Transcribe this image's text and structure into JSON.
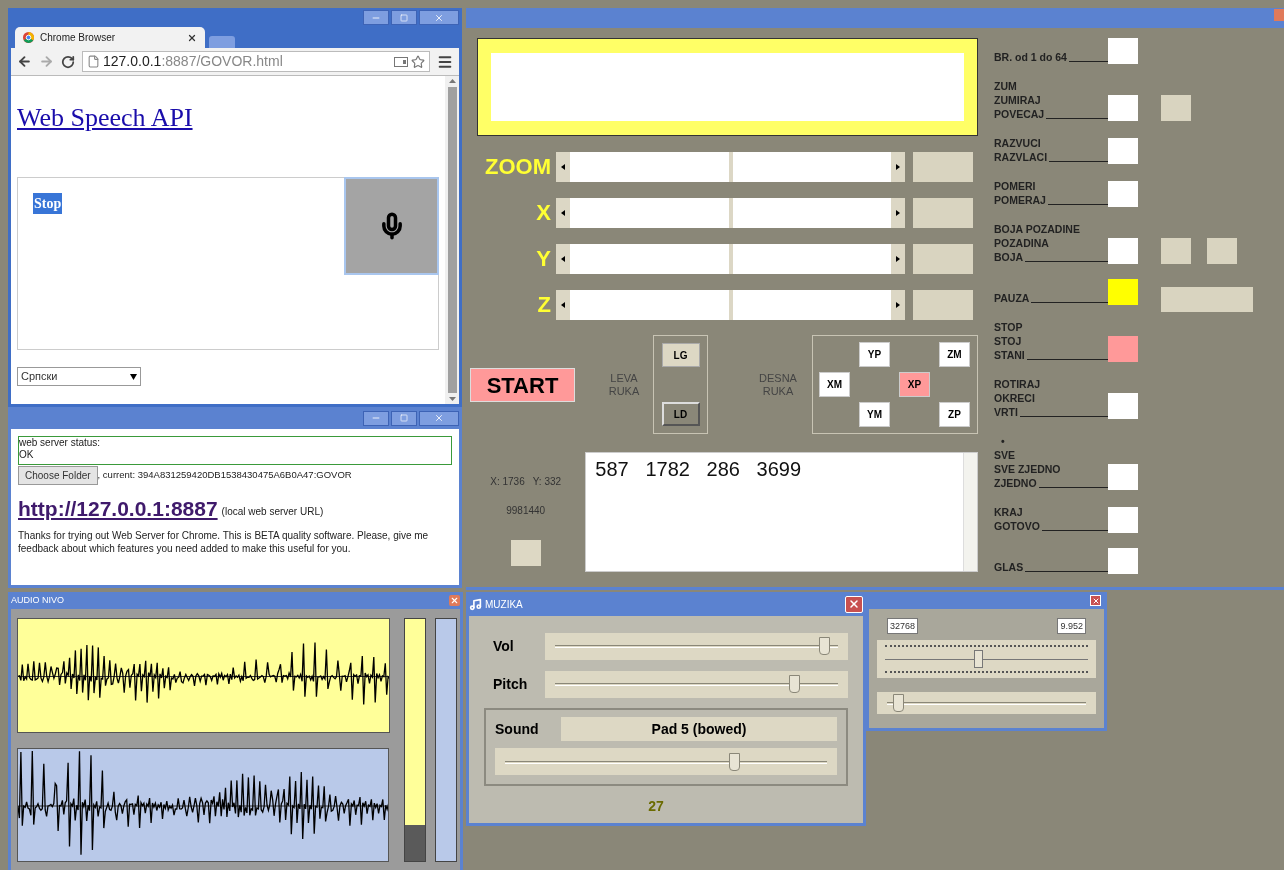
{
  "browser": {
    "tab": {
      "title": "Chrome Browser"
    },
    "url": {
      "host": "127.0.0.1",
      "rest": ":8887/GOVOR.html"
    },
    "page": {
      "heading": "Web Speech API",
      "transcript": "Stop",
      "transcript_selected": true,
      "language": "Српски"
    }
  },
  "server": {
    "status_lines": [
      "web server status:",
      "OK"
    ],
    "choose_folder": "Choose Folder",
    "current": ", current: 394A831259420DB1538430475A6B0A47:GOVOR",
    "url": "http://127.0.0.1:8887",
    "url_note": "(local web server URL)",
    "note": "Thanks for trying out Web Server for Chrome. This is BETA quality software. Please, give me feedback about which features you need added to make this useful for you."
  },
  "audio": {
    "title": "AUDIO NIVO",
    "meters": [
      {
        "level": 0.15
      },
      {
        "level": 0
      }
    ]
  },
  "main": {
    "axes": [
      {
        "label": "ZOOM",
        "level": 0.5
      },
      {
        "label": "X",
        "level": 0.5
      },
      {
        "label": "Y",
        "level": 0.5
      },
      {
        "label": "Z",
        "level": 0.5
      }
    ],
    "start": "START",
    "left_hand": {
      "lines": [
        "LEVA",
        "RUKA"
      ],
      "buttons": [
        {
          "label": "LG",
          "pressed": false
        },
        {
          "label": "LD",
          "pressed": true
        }
      ]
    },
    "right_hand": {
      "lines": [
        "DESNA",
        "RUKA"
      ],
      "buttons": [
        {
          "label": "YP",
          "selected": false
        },
        {
          "label": "ZM",
          "selected": false
        },
        {
          "label": "XM",
          "selected": false
        },
        {
          "label": "XP",
          "selected": true
        },
        {
          "label": "YM",
          "selected": false
        },
        {
          "label": "ZP",
          "selected": false
        }
      ]
    },
    "coords": [
      "X: 1736",
      "Y: 332"
    ],
    "counter": "9981440",
    "output": "587   1782   286   3699",
    "commands": [
      {
        "lines": [
          "BR. od 1 do 64"
        ],
        "color": "#ffffff"
      },
      {
        "lines": [
          "ZUM",
          "ZUMIRAJ",
          "POVECAJ"
        ],
        "color": "#ffffff"
      },
      {
        "lines": [
          "RAZVUCI",
          "RAZVLACI"
        ],
        "color": "#ffffff"
      },
      {
        "lines": [
          "POMERI",
          "POMERAJ"
        ],
        "color": "#ffffff"
      },
      {
        "lines": [
          "BOJA POZADINE",
          "POZADINA",
          "BOJA"
        ],
        "color": "#ffffff"
      },
      {
        "lines": [
          "PAUZA"
        ],
        "color": "#ffff00"
      },
      {
        "lines": [
          "STOP",
          "STOJ",
          "STANI"
        ],
        "color": "#ff9999"
      },
      {
        "lines": [
          "ROTIRAJ",
          "OKRECI",
          "VRTI"
        ],
        "color": "#ffffff"
      },
      {
        "lines": [
          "•",
          "SVE",
          "SVE ZJEDNO",
          "ZJEDNO"
        ],
        "color": "#ffffff"
      },
      {
        "lines": [
          "KRAJ",
          "GOTOVO"
        ],
        "color": "#ffffff"
      },
      {
        "lines": [
          "GLAS"
        ],
        "color": "#ffffff"
      }
    ]
  },
  "music": {
    "title": "MUZIKA",
    "sliders": [
      {
        "label": "Vol",
        "level": 0.97
      },
      {
        "label": "Pitch",
        "level": 0.86
      }
    ],
    "sound": {
      "label": "Sound",
      "value": "Pad 5 (bowed)",
      "level": 0.72
    },
    "value": "27"
  },
  "tuner": {
    "fields": [
      "32768",
      "9.952"
    ],
    "sliders": [
      {
        "kind": "ticked",
        "level": 0.46
      },
      {
        "kind": "plain",
        "level": 0.03
      }
    ]
  }
}
